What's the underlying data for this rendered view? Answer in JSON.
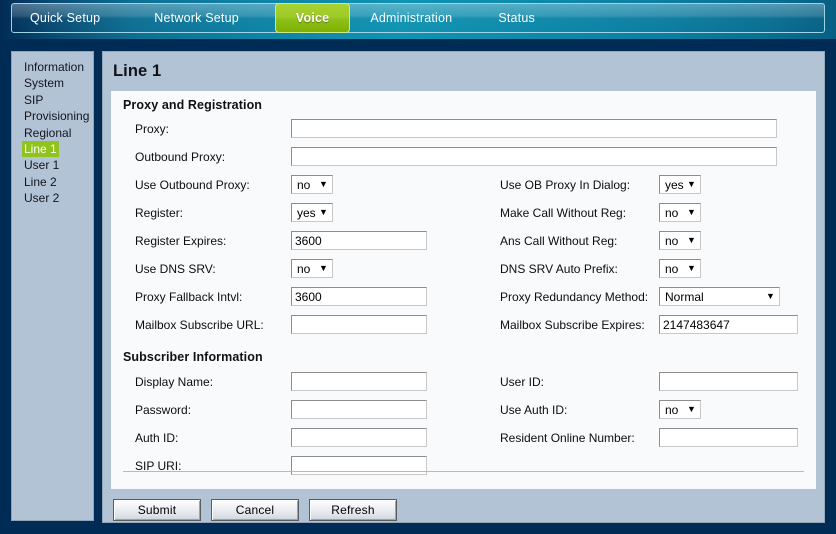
{
  "nav": {
    "tabs": [
      {
        "label": "Quick Setup",
        "active": false
      },
      {
        "label": "Network Setup",
        "active": false
      },
      {
        "label": "Voice",
        "active": true
      },
      {
        "label": "Administration",
        "active": false
      },
      {
        "label": "Status",
        "active": false
      }
    ],
    "active_color": "#8fc31e",
    "bar_color": "#0e82a4"
  },
  "sidebar": {
    "items": [
      {
        "label": "Information",
        "active": false
      },
      {
        "label": "System",
        "active": false
      },
      {
        "label": "SIP",
        "active": false
      },
      {
        "label": "Provisioning",
        "active": false
      },
      {
        "label": "Regional",
        "active": false
      },
      {
        "label": "Line 1",
        "active": true
      },
      {
        "label": "User 1",
        "active": false
      },
      {
        "label": "Line 2",
        "active": false
      },
      {
        "label": "User 2",
        "active": false
      }
    ],
    "highlight_color": "#8fc31e",
    "background_color": "#b3c3d6"
  },
  "page": {
    "title": "Line 1"
  },
  "sections": {
    "proxy": {
      "title": "Proxy and Registration",
      "left": [
        {
          "label": "Proxy:",
          "type": "text",
          "value": "",
          "width": "wide"
        },
        {
          "label": "Outbound Proxy:",
          "type": "text",
          "value": "",
          "width": "wide"
        },
        {
          "label": "Use Outbound Proxy:",
          "type": "select",
          "value": "no"
        },
        {
          "label": "Register:",
          "type": "select",
          "value": "yes"
        },
        {
          "label": "Register Expires:",
          "type": "text",
          "value": "3600",
          "width": "med"
        },
        {
          "label": "Use DNS SRV:",
          "type": "select",
          "value": "no"
        },
        {
          "label": "Proxy Fallback Intvl:",
          "type": "text",
          "value": "3600",
          "width": "med"
        },
        {
          "label": "Mailbox Subscribe URL:",
          "type": "text",
          "value": "",
          "width": "med"
        }
      ],
      "right": [
        {
          "label": "Use OB Proxy In Dialog:",
          "type": "select",
          "value": "yes"
        },
        {
          "label": "Make Call Without Reg:",
          "type": "select",
          "value": "no"
        },
        {
          "label": "Ans Call Without Reg:",
          "type": "select",
          "value": "no"
        },
        {
          "label": "DNS SRV Auto Prefix:",
          "type": "select",
          "value": "no"
        },
        {
          "label": "Proxy Redundancy Method:",
          "type": "select-lg",
          "value": "Normal"
        },
        {
          "label": "Mailbox Subscribe Expires:",
          "type": "text",
          "value": "2147483647",
          "width": "right"
        }
      ]
    },
    "subscriber": {
      "title": "Subscriber Information",
      "left": [
        {
          "label": "Display Name:",
          "type": "text",
          "value": "",
          "width": "med"
        },
        {
          "label": "Password:",
          "type": "text",
          "value": "",
          "width": "med"
        },
        {
          "label": "Auth ID:",
          "type": "text",
          "value": "",
          "width": "med"
        },
        {
          "label": "SIP URI:",
          "type": "text",
          "value": "",
          "width": "med"
        }
      ],
      "right": [
        {
          "label": "User ID:",
          "type": "text",
          "value": "",
          "width": "right"
        },
        {
          "label": "Use Auth ID:",
          "type": "select",
          "value": "no"
        },
        {
          "label": "Resident Online Number:",
          "type": "text",
          "value": "",
          "width": "right"
        }
      ]
    }
  },
  "buttons": [
    {
      "label": "Submit"
    },
    {
      "label": "Cancel"
    },
    {
      "label": "Refresh"
    }
  ],
  "icons": {
    "dropdown": "▼"
  }
}
